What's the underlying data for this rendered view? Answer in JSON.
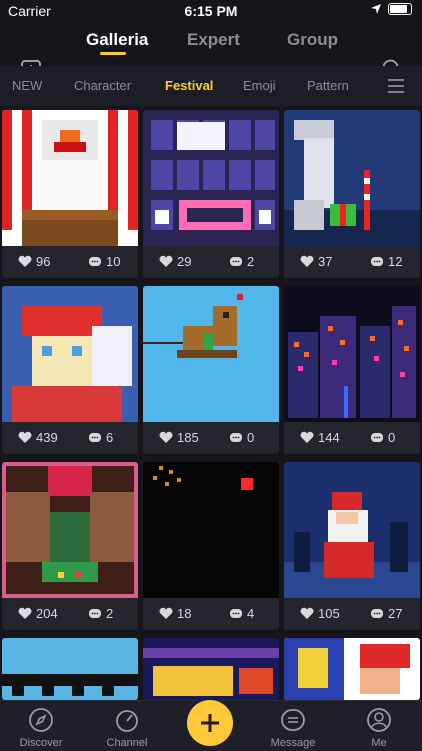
{
  "status_bar": {
    "carrier": "Carrier",
    "time": "6:15 PM"
  },
  "top_tabs": [
    {
      "label": "Galleria"
    },
    {
      "label": "Expert"
    },
    {
      "label": "Group"
    }
  ],
  "categories": [
    {
      "label": "NEW"
    },
    {
      "label": "Character"
    },
    {
      "label": "Festival"
    },
    {
      "label": "Emoji"
    },
    {
      "label": "Pattern"
    }
  ],
  "selected_category": "Festival",
  "artworks": [
    {
      "likes": "96",
      "comments": "10"
    },
    {
      "likes": "29",
      "comments": "2"
    },
    {
      "likes": "37",
      "comments": "12"
    },
    {
      "likes": "439",
      "comments": "6"
    },
    {
      "likes": "185",
      "comments": "0"
    },
    {
      "likes": "144",
      "comments": "0"
    },
    {
      "likes": "204",
      "comments": "2"
    },
    {
      "likes": "18",
      "comments": "4"
    },
    {
      "likes": "105",
      "comments": "27"
    },
    {
      "likes": "",
      "comments": ""
    },
    {
      "likes": "",
      "comments": ""
    },
    {
      "likes": "",
      "comments": ""
    }
  ],
  "bottom_tabs": [
    {
      "label": "Discover"
    },
    {
      "label": "Channel"
    },
    {
      "label": "Message"
    },
    {
      "label": "Me"
    }
  ],
  "accent_color": "#ffc93a"
}
